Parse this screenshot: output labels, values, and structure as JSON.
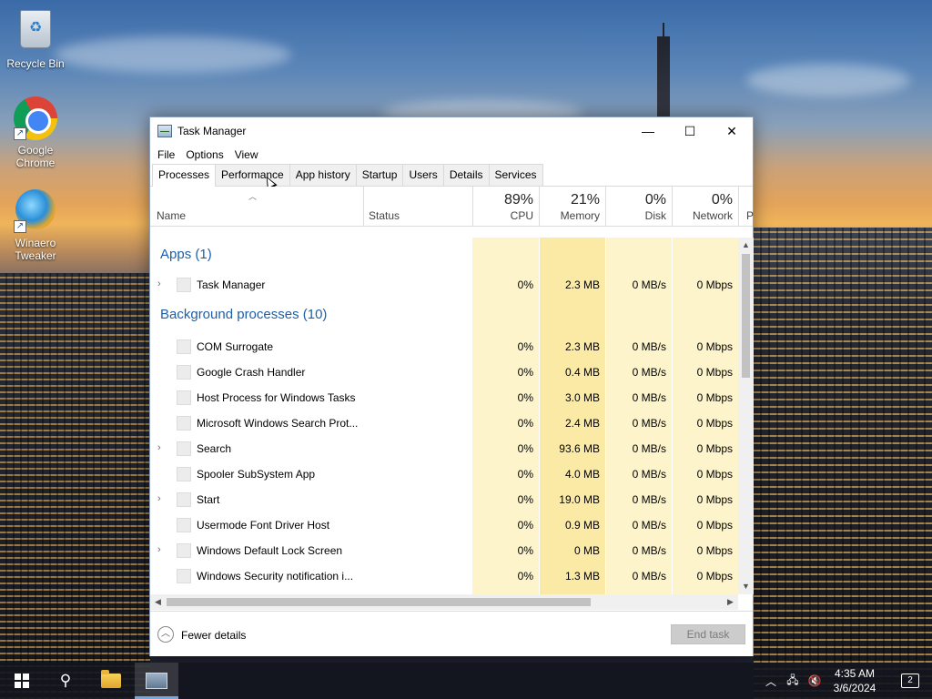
{
  "desktop": {
    "icons": [
      {
        "label": "Recycle Bin",
        "icon": "recycle-bin-icon"
      },
      {
        "label": "Google Chrome",
        "icon": "chrome-icon"
      },
      {
        "label": "Winaero Tweaker",
        "icon": "winaero-tweaker-icon"
      }
    ]
  },
  "window": {
    "title": "Task Manager",
    "controls": {
      "minimize": "—",
      "maximize": "☐",
      "close": "✕"
    },
    "menu": [
      "File",
      "Options",
      "View"
    ],
    "tabs": [
      "Processes",
      "Performance",
      "App history",
      "Startup",
      "Users",
      "Details",
      "Services"
    ],
    "active_tab": "Processes",
    "columns": {
      "name": "Name",
      "status": "Status",
      "cpu": {
        "pct": "89%",
        "label": "CPU"
      },
      "memory": {
        "pct": "21%",
        "label": "Memory"
      },
      "disk": {
        "pct": "0%",
        "label": "Disk"
      },
      "network": {
        "pct": "0%",
        "label": "Network"
      },
      "power_truncated": "P"
    },
    "groups": {
      "apps": {
        "title": "Apps (1)",
        "items": [
          {
            "name": "Task Manager",
            "expandable": true,
            "cpu": "0%",
            "memory": "2.3 MB",
            "disk": "0 MB/s",
            "network": "0 Mbps"
          }
        ]
      },
      "background": {
        "title": "Background processes (10)",
        "items": [
          {
            "name": "COM Surrogate",
            "expandable": false,
            "cpu": "0%",
            "memory": "2.3 MB",
            "disk": "0 MB/s",
            "network": "0 Mbps"
          },
          {
            "name": "Google Crash Handler",
            "expandable": false,
            "cpu": "0%",
            "memory": "0.4 MB",
            "disk": "0 MB/s",
            "network": "0 Mbps"
          },
          {
            "name": "Host Process for Windows Tasks",
            "expandable": false,
            "cpu": "0%",
            "memory": "3.0 MB",
            "disk": "0 MB/s",
            "network": "0 Mbps"
          },
          {
            "name": "Microsoft Windows Search Prot...",
            "expandable": false,
            "cpu": "0%",
            "memory": "2.4 MB",
            "disk": "0 MB/s",
            "network": "0 Mbps"
          },
          {
            "name": "Search",
            "expandable": true,
            "cpu": "0%",
            "memory": "93.6 MB",
            "disk": "0 MB/s",
            "network": "0 Mbps"
          },
          {
            "name": "Spooler SubSystem App",
            "expandable": false,
            "cpu": "0%",
            "memory": "4.0 MB",
            "disk": "0 MB/s",
            "network": "0 Mbps"
          },
          {
            "name": "Start",
            "expandable": true,
            "cpu": "0%",
            "memory": "19.0 MB",
            "disk": "0 MB/s",
            "network": "0 Mbps"
          },
          {
            "name": "Usermode Font Driver Host",
            "expandable": false,
            "cpu": "0%",
            "memory": "0.9 MB",
            "disk": "0 MB/s",
            "network": "0 Mbps"
          },
          {
            "name": "Windows Default Lock Screen",
            "expandable": true,
            "cpu": "0%",
            "memory": "0 MB",
            "disk": "0 MB/s",
            "network": "0 Mbps"
          },
          {
            "name": "Windows Security notification i...",
            "expandable": false,
            "cpu": "0%",
            "memory": "1.3 MB",
            "disk": "0 MB/s",
            "network": "0 Mbps"
          }
        ]
      }
    },
    "footer": {
      "fewer_details": "Fewer details",
      "end_task": "End task"
    }
  },
  "taskbar": {
    "clock_time": "4:35 AM",
    "clock_date": "3/6/2024",
    "notification_count": "2",
    "tray_icons": [
      "chevron-up-icon",
      "network-icon",
      "volume-muted-icon"
    ]
  },
  "colors": {
    "group_title": "#1f5fa8",
    "cpu_column_bg": "#fdf4cc",
    "memory_column_bg": "#fbeaa6",
    "other_column_bg": "#fdf4cc"
  }
}
